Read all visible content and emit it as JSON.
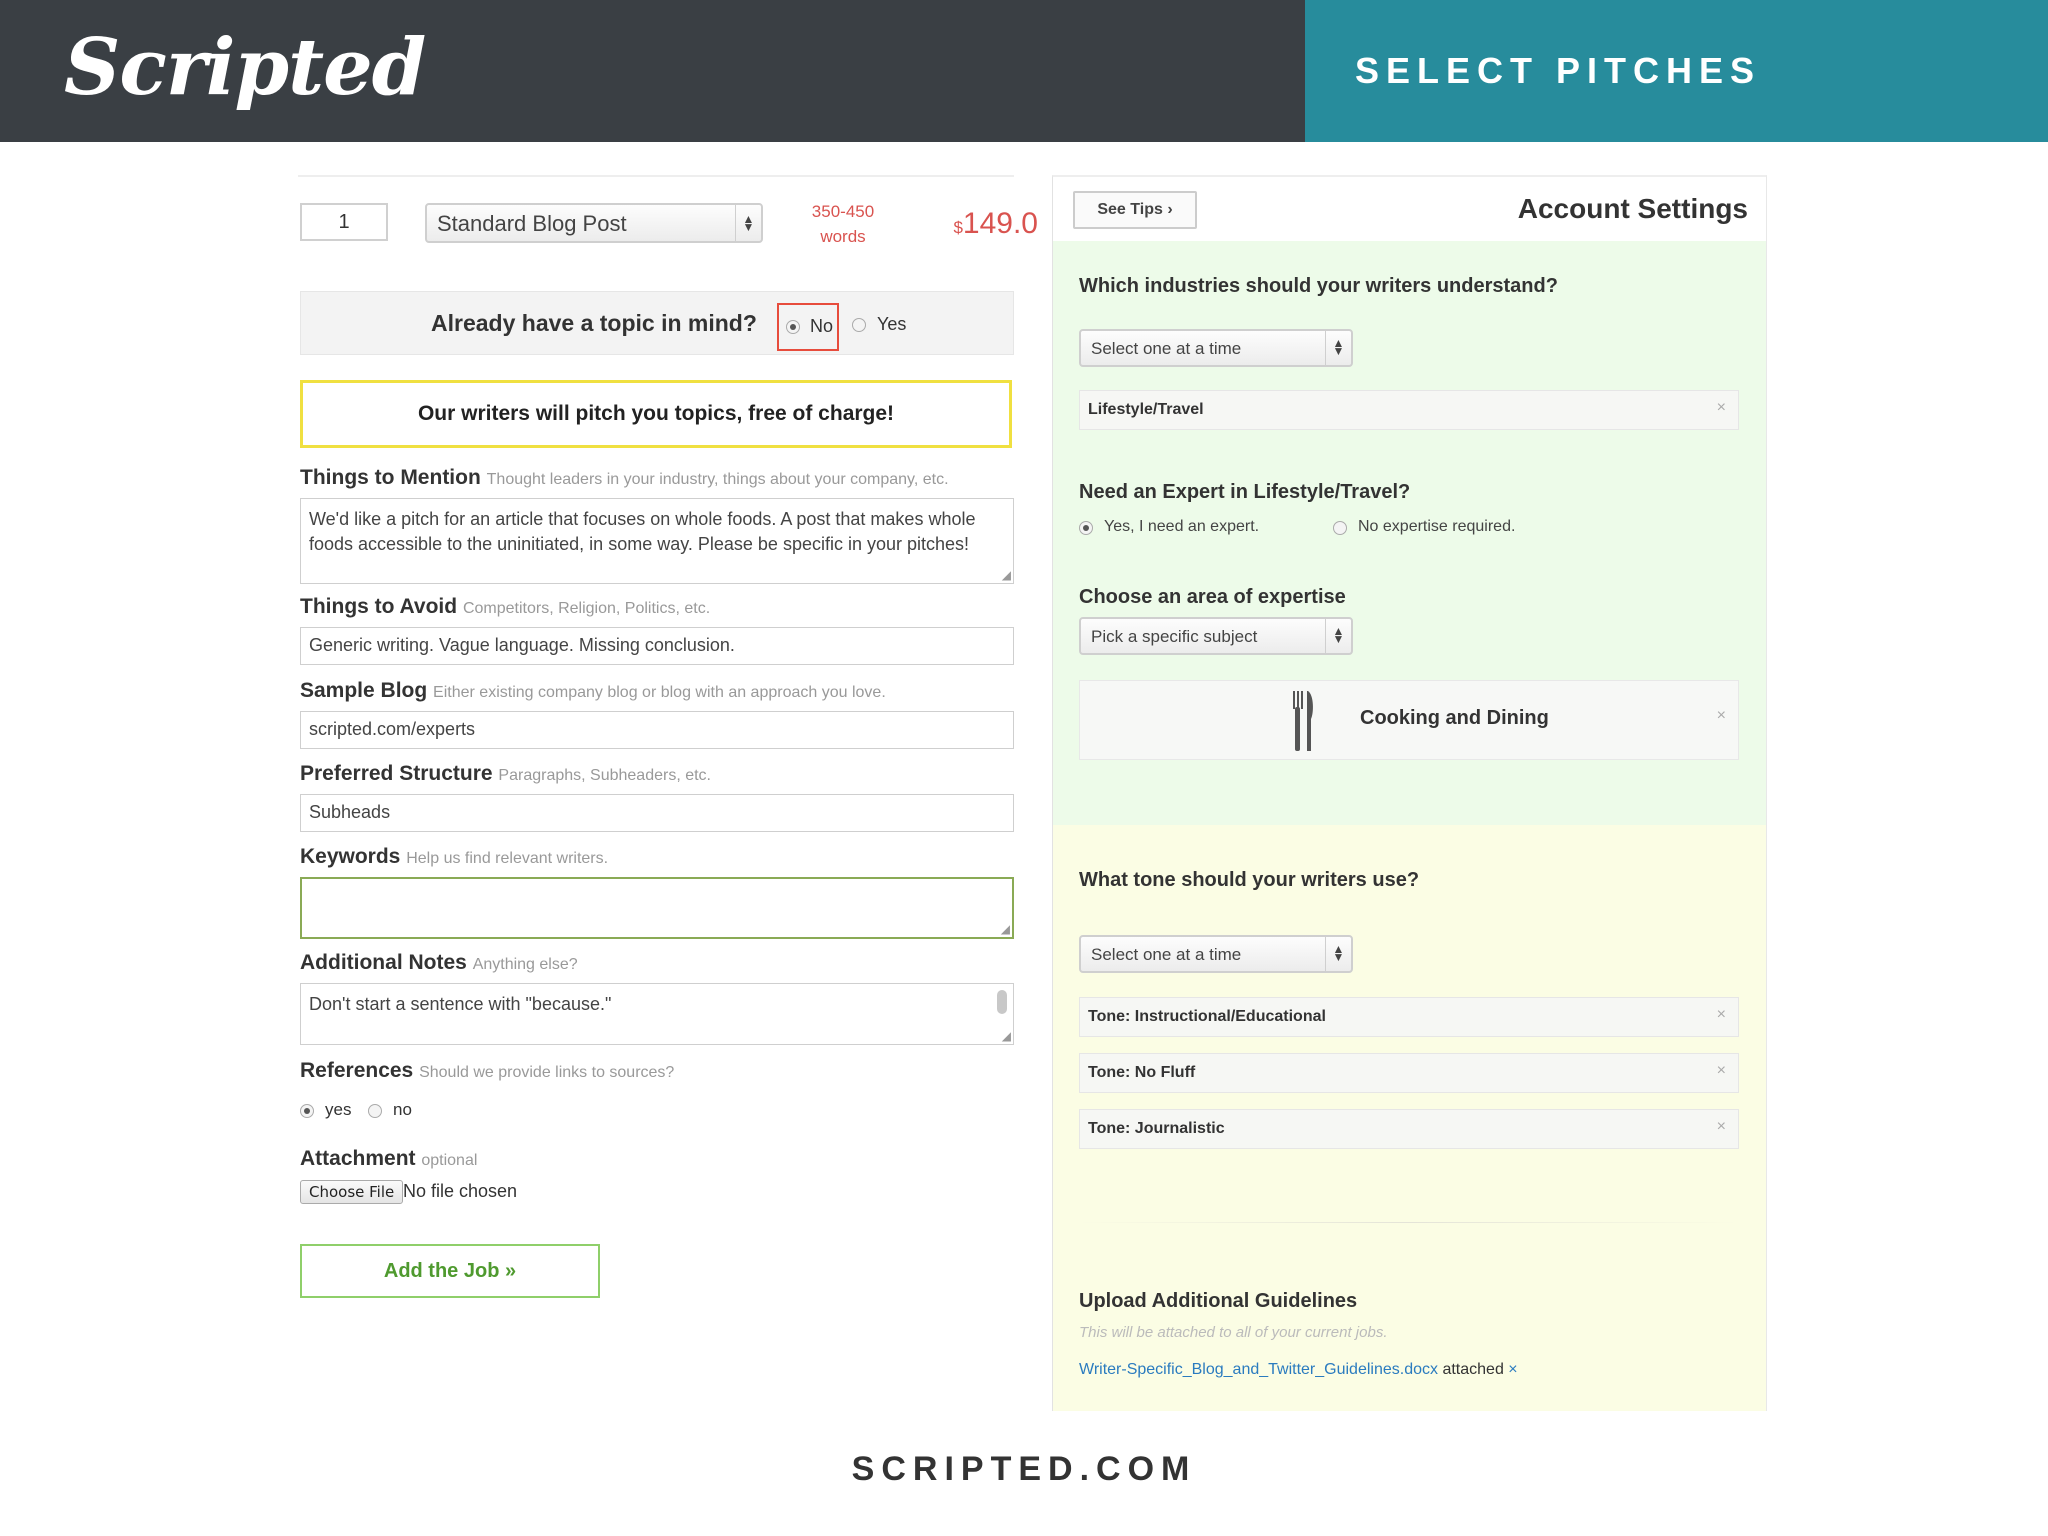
{
  "header": {
    "logo": "Scripted",
    "title": "SELECT PITCHES"
  },
  "order": {
    "quantity": "1",
    "type_selected": "Standard Blog Post",
    "words_range": "350-450",
    "words_label": "words",
    "price_currency": "$",
    "price": "149.0"
  },
  "topic": {
    "question": "Already have a topic in mind?",
    "no_label": "No",
    "yes_label": "Yes",
    "selected": "No"
  },
  "pitch_notice": "Our writers will pitch you topics, free of charge!",
  "fields": {
    "mention": {
      "label": "Things to Mention",
      "hint": "Thought leaders in your industry, things about your company, etc.",
      "value": "We'd like a pitch for an article that focuses on whole foods. A post that makes whole foods accessible to the uninitiated, in some way. Please be specific in your pitches!"
    },
    "avoid": {
      "label": "Things to Avoid",
      "hint": "Competitors, Religion, Politics, etc.",
      "value": "Generic writing. Vague language. Missing conclusion."
    },
    "sample": {
      "label": "Sample Blog",
      "hint": "Either existing company blog or blog with an approach you love.",
      "value": "scripted.com/experts"
    },
    "structure": {
      "label": "Preferred Structure",
      "hint": "Paragraphs, Subheaders, etc.",
      "value": "Subheads"
    },
    "keywords": {
      "label": "Keywords",
      "hint": "Help us find relevant writers.",
      "value": ""
    },
    "notes": {
      "label": "Additional Notes",
      "hint": "Anything else?",
      "value": "Don't start a sentence with \"because.\""
    },
    "references": {
      "label": "References",
      "hint": "Should we provide links to sources?",
      "yes_label": "yes",
      "no_label": "no",
      "selected": "yes"
    },
    "attachment": {
      "label": "Attachment",
      "hint": "optional",
      "button": "Choose File",
      "status": "No file chosen"
    }
  },
  "add_job": "Add the Job »",
  "account": {
    "see_tips": "See Tips",
    "title": "Account Settings",
    "industries_q": "Which industries should your writers understand?",
    "industries_select": "Select one at a time",
    "industry_tag": "Lifestyle/Travel",
    "expert_q": "Need an Expert in Lifestyle/Travel?",
    "expert_yes": "Yes, I need an expert.",
    "expert_no": "No expertise required.",
    "expert_selected": "yes",
    "area_q": "Choose an area of expertise",
    "area_select": "Pick a specific subject",
    "area_tag": "Cooking and Dining",
    "tone_q": "What tone should your writers use?",
    "tone_select": "Select one at a time",
    "tones": [
      "Tone: Instructional/Educational",
      "Tone: No Fluff",
      "Tone: Journalistic"
    ],
    "upload_title": "Upload Additional Guidelines",
    "upload_hint": "This will be attached to all of your current jobs.",
    "upload_file": "Writer-Specific_Blog_and_Twitter_Guidelines.docx",
    "upload_attached": "attached",
    "remove_mark": "×"
  },
  "footer": "SCRIPTED.COM",
  "colors": {
    "header_dark": "#3a3f44",
    "header_teal": "#278c9c",
    "price_red": "#d9534f",
    "highlight_yellow": "#f0e040",
    "button_green": "#4f9a2f",
    "panel_green": "#edfbe9",
    "panel_yellow": "#fbfde4",
    "link_blue": "#2a7bbf"
  },
  "icons": [
    "chevron-right-icon",
    "select-arrows-icon",
    "remove-x-icon",
    "fork-knife-icon",
    "resize-handle-icon"
  ]
}
